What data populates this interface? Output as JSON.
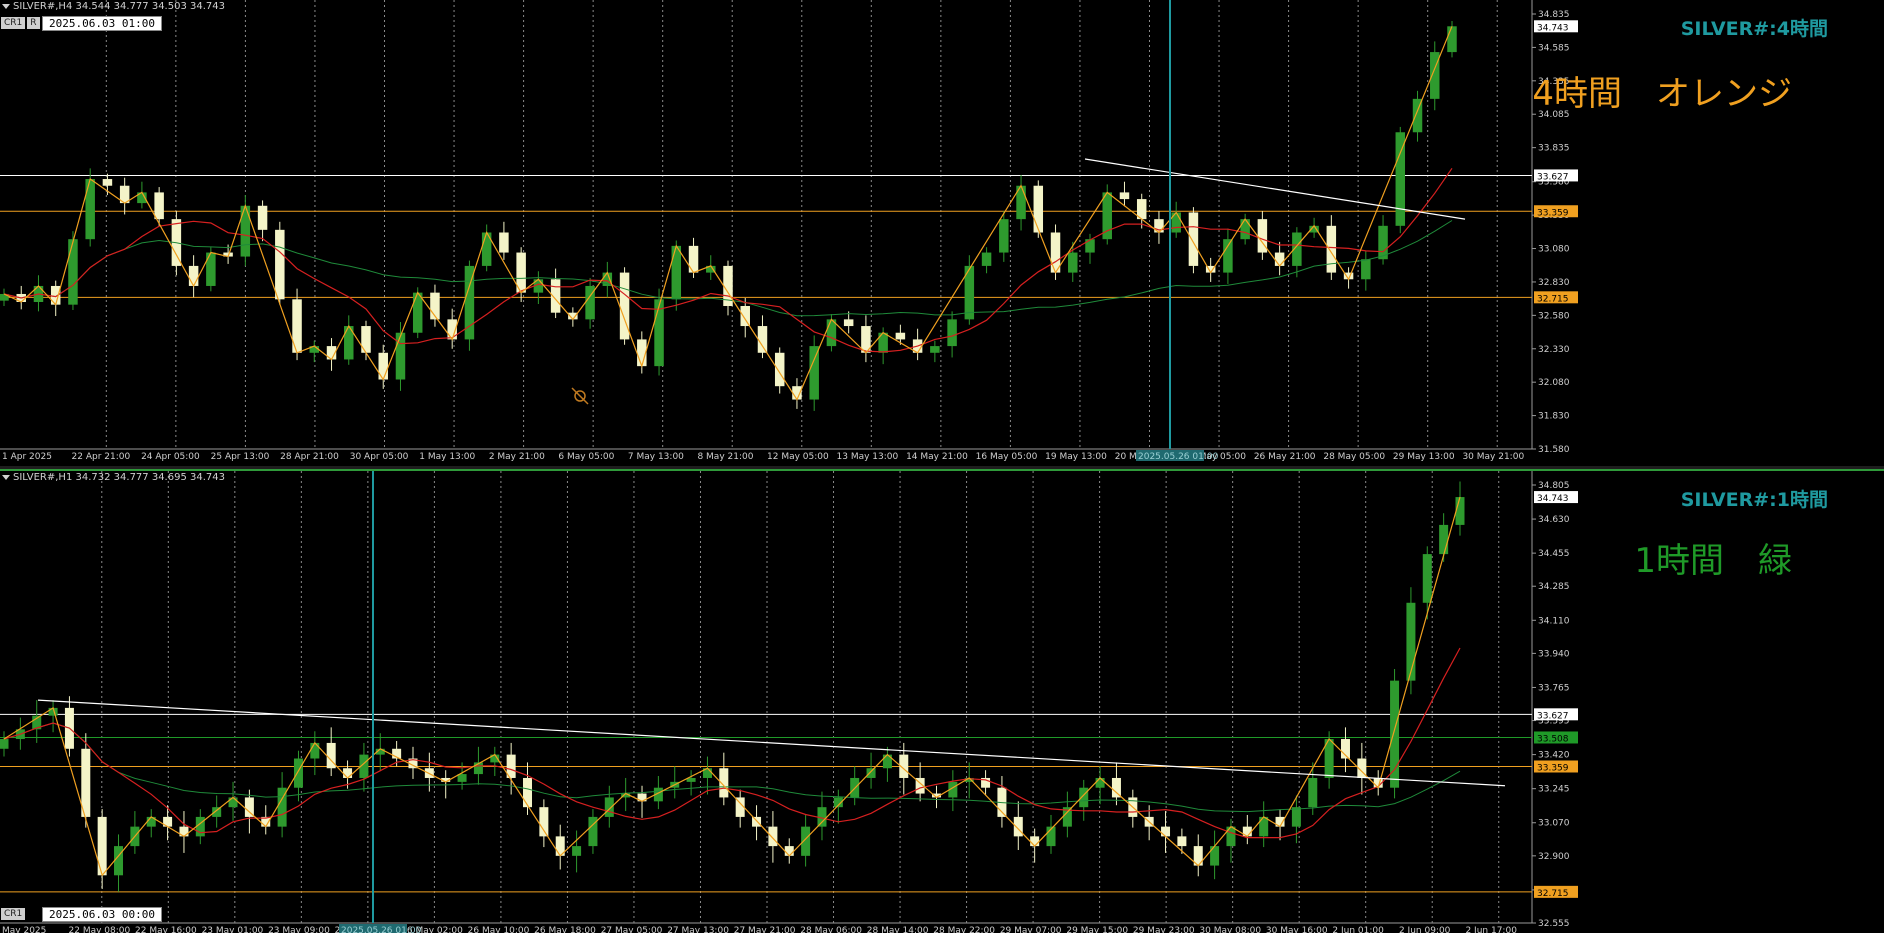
{
  "top": {
    "header": "SILVER#,H4  34.544 34.777 34.503 34.743",
    "buttons": [
      "CR1",
      "R"
    ],
    "date_box": "2025.06.03 01:00",
    "title": "SILVER#:4時間",
    "note": "4時間　オレンジ",
    "note_color": "#f0a020",
    "ylim": [
      31.58,
      34.835
    ],
    "yticks": [
      "34.835",
      "34.585",
      "34.335",
      "34.085",
      "33.835",
      "33.580",
      "33.330",
      "33.080",
      "32.830",
      "32.580",
      "32.330",
      "32.080",
      "31.830",
      "31.580"
    ],
    "hlines": [
      {
        "value": 33.627,
        "label": "33.627",
        "color": "#ffffff"
      },
      {
        "value": 33.359,
        "label": "33.359",
        "color": "#f0a020"
      },
      {
        "value": 32.715,
        "label": "32.715",
        "color": "#f0a020"
      }
    ],
    "price_badge": "34.743",
    "xticks": [
      "1 Apr 2025",
      "22 Apr 21:00",
      "24 Apr 05:00",
      "25 Apr 13:00",
      "28 Apr 21:00",
      "30 Apr 05:00",
      "1 May 13:00",
      "2 May 21:00",
      "6 May 05:00",
      "7 May 13:00",
      "8 May 21:00",
      "12 May 05:00",
      "13 May 13:00",
      "14 May 21:00",
      "16 May 05:00",
      "19 May 13:00",
      "20 May 21:00",
      "22 May 05:00",
      "26 May 21:00",
      "28 May 05:00",
      "29 May 13:00",
      "30 May 21:00"
    ],
    "crosshair_label": "2025.05.26 01:00"
  },
  "bottom": {
    "header": "SILVER#,H1  34.732 34.777 34.695 34.743",
    "buttons": [
      "CR1",
      "R"
    ],
    "date_box": "2025.06.03 00:00",
    "title": "SILVER#:1時間",
    "note": "1時間　緑",
    "note_color": "#1f9a28",
    "ylim": [
      32.555,
      34.805
    ],
    "yticks": [
      "34.805",
      "34.630",
      "34.455",
      "34.285",
      "34.110",
      "33.940",
      "33.765",
      "33.595",
      "33.420",
      "33.245",
      "33.070",
      "32.900",
      "32.725",
      "32.555"
    ],
    "hlines": [
      {
        "value": 33.627,
        "label": "33.627",
        "color": "#ffffff"
      },
      {
        "value": 33.508,
        "label": "33.508",
        "color": "#1f9a28"
      },
      {
        "value": 33.359,
        "label": "33.359",
        "color": "#f0a020"
      },
      {
        "value": 32.715,
        "label": "32.715",
        "color": "#f0a020"
      }
    ],
    "price_badge": "34.743",
    "xticks": [
      "May 2025",
      "22 May 08:00",
      "22 May 16:00",
      "23 May 01:00",
      "23 May 09:00",
      "23 M",
      "26 May 02:00",
      "26 May 10:00",
      "26 May 18:00",
      "27 May 05:00",
      "27 May 13:00",
      "27 May 21:00",
      "28 May 06:00",
      "28 May 14:00",
      "28 May 22:00",
      "29 May 07:00",
      "29 May 15:00",
      "29 May 23:00",
      "30 May 08:00",
      "30 May 16:00",
      "2 Jun 01:00",
      "2 Jun 09:00",
      "2 Jun 17:00"
    ],
    "crosshair_label": "2025.05.26 01:00"
  },
  "chart_data": [
    {
      "type": "candlestick",
      "title": "SILVER#:4時間",
      "ylim": [
        31.58,
        34.835
      ],
      "series": [
        {
          "name": "close",
          "values": [
            32.74,
            32.68,
            32.8,
            32.66,
            33.15,
            33.6,
            33.55,
            33.42,
            33.5,
            33.3,
            32.95,
            32.8,
            33.05,
            33.02,
            33.4,
            33.22,
            32.7,
            32.3,
            32.35,
            32.25,
            32.5,
            32.3,
            32.1,
            32.45,
            32.75,
            32.55,
            32.4,
            32.95,
            33.2,
            33.05,
            32.75,
            32.85,
            32.6,
            32.55,
            32.8,
            32.9,
            32.4,
            32.2,
            32.7,
            33.1,
            32.9,
            32.95,
            32.65,
            32.5,
            32.3,
            32.05,
            31.95,
            32.35,
            32.55,
            32.5,
            32.3,
            32.45,
            32.4,
            32.3,
            32.35,
            32.55,
            32.95,
            33.05,
            33.3,
            33.55,
            33.2,
            32.9,
            33.05,
            33.15,
            33.5,
            33.45,
            33.3,
            33.2,
            33.35,
            32.95,
            32.9,
            33.15,
            33.3,
            33.05,
            32.95,
            33.2,
            33.25,
            32.9,
            32.85,
            33.0,
            33.25,
            33.95,
            34.2,
            34.55,
            34.743
          ]
        }
      ]
    },
    {
      "type": "candlestick",
      "title": "SILVER#:1時間",
      "ylim": [
        32.555,
        34.805
      ],
      "series": [
        {
          "name": "close",
          "values": [
            33.5,
            33.55,
            33.62,
            33.66,
            33.45,
            33.1,
            32.8,
            32.95,
            33.05,
            33.1,
            33.05,
            33.0,
            33.1,
            33.15,
            33.2,
            33.1,
            33.05,
            33.25,
            33.4,
            33.48,
            33.35,
            33.3,
            33.42,
            33.45,
            33.4,
            33.35,
            33.3,
            33.28,
            33.32,
            33.38,
            33.42,
            33.3,
            33.15,
            33.0,
            32.9,
            32.95,
            33.1,
            33.2,
            33.22,
            33.18,
            33.25,
            33.28,
            33.3,
            33.35,
            33.2,
            33.1,
            33.05,
            32.95,
            32.9,
            33.05,
            33.15,
            33.2,
            33.3,
            33.35,
            33.42,
            33.3,
            33.22,
            33.2,
            33.28,
            33.3,
            33.25,
            33.1,
            33.0,
            32.95,
            33.05,
            33.15,
            33.25,
            33.3,
            33.2,
            33.1,
            33.05,
            33.0,
            32.95,
            32.85,
            32.95,
            33.05,
            33.0,
            33.1,
            33.05,
            33.15,
            33.3,
            33.5,
            33.4,
            33.3,
            33.25,
            33.8,
            34.2,
            34.45,
            34.6,
            34.743
          ]
        }
      ]
    }
  ]
}
